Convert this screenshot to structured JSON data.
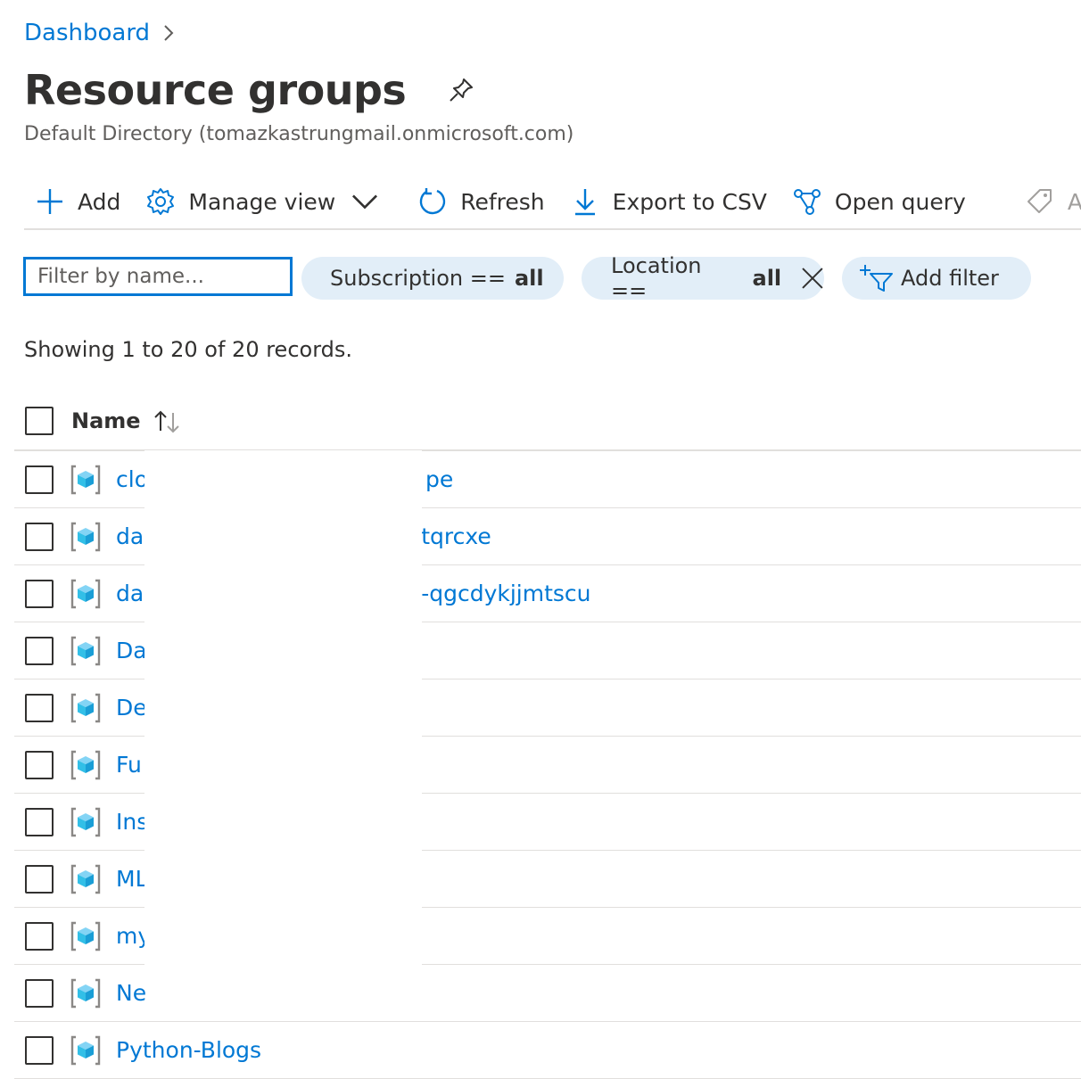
{
  "breadcrumb": {
    "root": "Dashboard"
  },
  "page": {
    "title": "Resource groups",
    "subtitle": "Default Directory (tomazkastrungmail.onmicrosoft.com)"
  },
  "toolbar": {
    "add": "Add",
    "manage_view": "Manage view",
    "refresh": "Refresh",
    "export_csv": "Export to CSV",
    "open_query": "Open query",
    "assign_tags": "Assign"
  },
  "filters": {
    "name_placeholder": "Filter by name...",
    "subscription_label": "Subscription ==",
    "subscription_value": "all",
    "location_label": "Location ==",
    "location_value": "all",
    "add_filter": "Add filter"
  },
  "records_text": "Showing 1 to 20 of 20 records.",
  "table": {
    "column_name": "Name",
    "rows": [
      {
        "prefix": "clo",
        "suffix": "pe"
      },
      {
        "prefix": "da",
        "suffix": "tqrcxe"
      },
      {
        "prefix": "da",
        "suffix": "-qgcdykjjmtscu"
      },
      {
        "prefix": "Da",
        "suffix": ""
      },
      {
        "prefix": "De",
        "suffix": ""
      },
      {
        "prefix": "Fu",
        "suffix": ""
      },
      {
        "prefix": "Ins",
        "suffix": ""
      },
      {
        "prefix": "ML",
        "suffix": ""
      },
      {
        "prefix": "my",
        "suffix": ""
      },
      {
        "prefix": "Ne",
        "suffix": ""
      },
      {
        "prefix": "Python-Blogs",
        "suffix": ""
      }
    ]
  },
  "colors": {
    "accent": "#0078d4",
    "pill_bg": "#e2eef8",
    "text": "#323130"
  },
  "icons": {
    "breadcrumb": "chevron-right-icon",
    "pin": "pin-icon",
    "add": "plus-icon",
    "manage_view": "gear-icon",
    "refresh": "refresh-icon",
    "export": "download-icon",
    "open_query": "query-graph-icon",
    "assign": "tag-icon",
    "location_clear": "close-icon",
    "add_filter": "filter-add-icon",
    "sort": "sort-icon",
    "row": "resource-group-icon"
  }
}
